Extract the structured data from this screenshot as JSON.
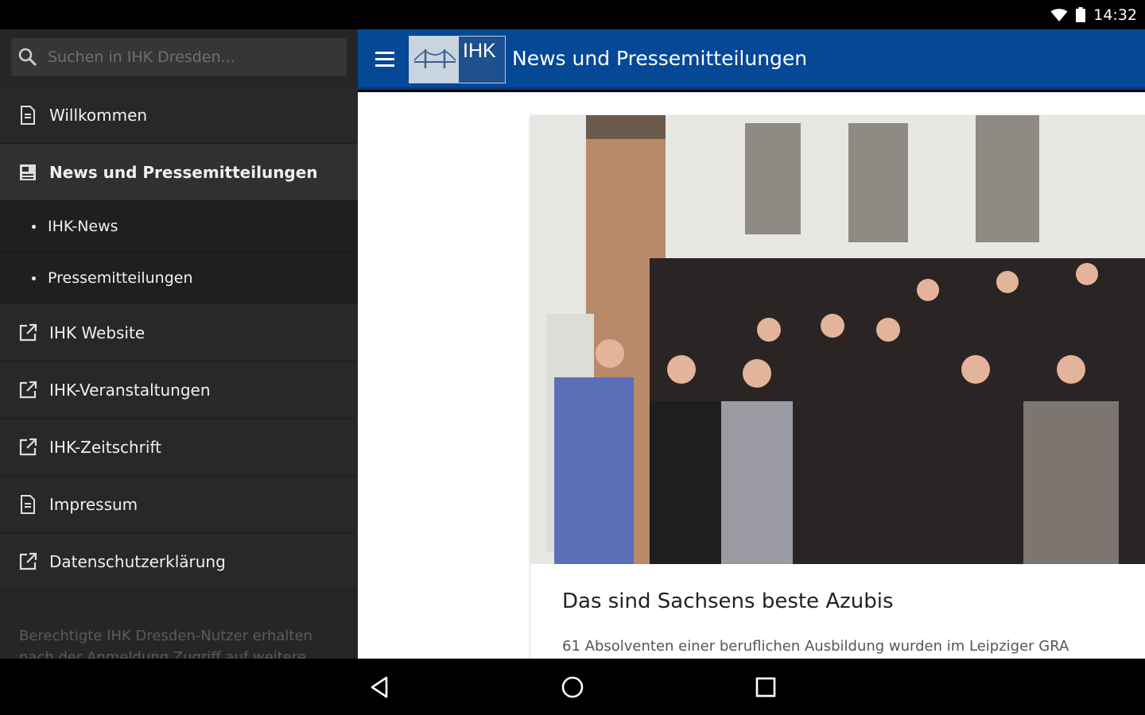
{
  "status_bar": {
    "time": "14:32"
  },
  "drawer": {
    "search": {
      "placeholder": "Suchen in IHK Dresden..."
    },
    "items": [
      {
        "label": "Willkommen",
        "icon": "document-icon"
      },
      {
        "label": "News und Pressemitteilungen",
        "icon": "newspaper-icon",
        "active": true
      },
      {
        "label": "IHK-News",
        "sub": true
      },
      {
        "label": "Pressemitteilungen",
        "sub": true
      },
      {
        "label": "IHK Website",
        "icon": "external-link-icon"
      },
      {
        "label": "IHK-Veranstaltungen",
        "icon": "external-link-icon"
      },
      {
        "label": "IHK-Zeitschrift",
        "icon": "external-link-icon"
      },
      {
        "label": "Impressum",
        "icon": "document-icon"
      },
      {
        "label": "Datenschutzerklärung",
        "icon": "external-link-icon"
      }
    ],
    "footer": "Berechtigte IHK Dresden-Nutzer erhalten nach der Anmeldung Zugriff auf weitere"
  },
  "appbar": {
    "logo_text": "IHK",
    "title": "News und Pressemitteilungen",
    "color": "#054896"
  },
  "article": {
    "title": "Das sind Sachsens beste Azubis",
    "teaser": "61 Absolventen einer beruflichen Ausbildung wurden im Leipziger GRA"
  },
  "colors": {
    "drawer_bg": "#262626",
    "accent": "#054896"
  }
}
